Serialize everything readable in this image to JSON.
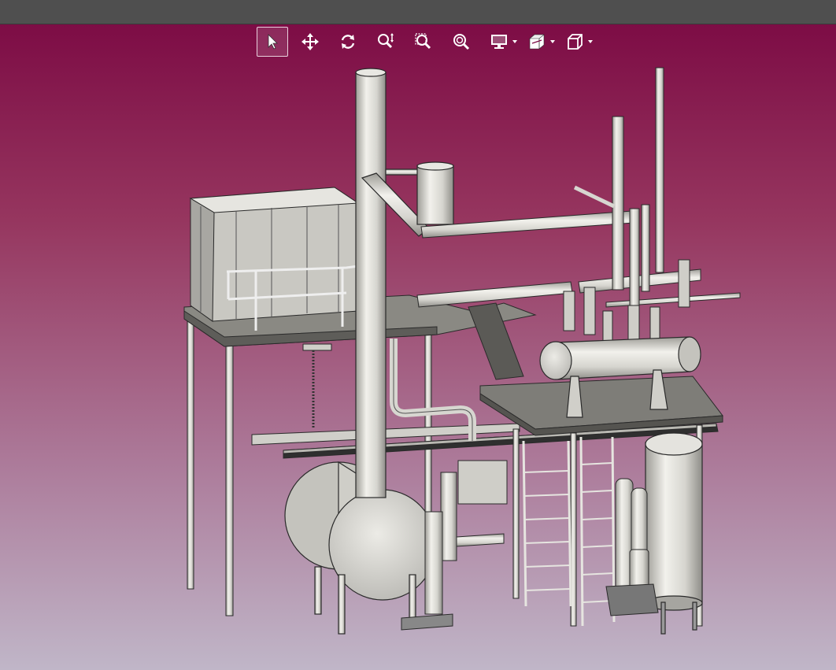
{
  "window": {
    "titlebar_color": "#4f4f4f",
    "background_top": "#7d0c45",
    "background_bottom": "#c0b6c8"
  },
  "toolbar": {
    "buttons": [
      {
        "id": "select",
        "icon": "cursor-arrow-icon",
        "active": true
      },
      {
        "id": "pan",
        "icon": "move-arrows-icon",
        "active": false
      },
      {
        "id": "rotate",
        "icon": "rotate-icon",
        "active": false
      },
      {
        "id": "zoom",
        "icon": "zoom-vertical-icon",
        "active": false
      },
      {
        "id": "zoom-window",
        "icon": "zoom-window-icon",
        "active": false
      },
      {
        "id": "zoom-fit",
        "icon": "zoom-fit-icon",
        "active": false
      },
      {
        "id": "display",
        "icon": "monitor-icon",
        "active": false,
        "dropdown": true
      },
      {
        "id": "section",
        "icon": "section-view-icon",
        "active": false,
        "dropdown": true
      },
      {
        "id": "view-cube",
        "icon": "cube-view-icon",
        "active": false,
        "dropdown": true
      }
    ]
  },
  "model": {
    "metal_color": "#d9d8d2",
    "edge_color": "#2a2a2a"
  }
}
